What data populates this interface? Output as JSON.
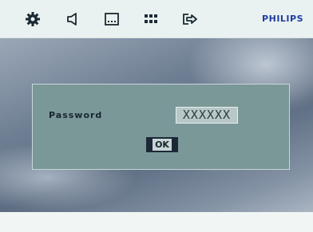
{
  "toolbar": {
    "icons": [
      "gear-icon",
      "speaker-icon",
      "subtitle-icon",
      "grid-icon",
      "exit-icon"
    ],
    "brand": "PHILIPS",
    "brand_color": "#1f3ea0"
  },
  "dialog": {
    "label": "Password",
    "field_value": "XXXXXX",
    "ok_label": "OK"
  },
  "colors": {
    "dialog_bg": "#7b9899",
    "bar_bg": "#eaf2f1"
  }
}
